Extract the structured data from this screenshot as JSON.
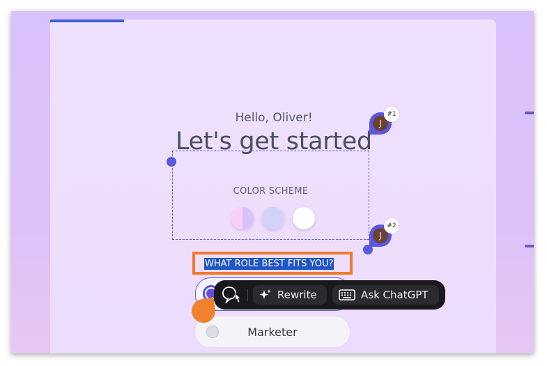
{
  "greeting": "Hello, Oliver!",
  "heading": "Let's get started",
  "color_scheme": {
    "label": "COLOR SCHEME",
    "swatches": [
      {
        "name": "split-pink-lavender",
        "colors": [
          "#fbd0f4",
          "#d6c3fb"
        ]
      },
      {
        "name": "periwinkle",
        "colors": [
          "#d3d2fb"
        ]
      },
      {
        "name": "white",
        "colors": [
          "#ffffff"
        ]
      }
    ]
  },
  "role_question": "WHAT ROLE BEST FITS YOU?",
  "options": [
    {
      "label": "Marketer",
      "selected": false
    }
  ],
  "toolbar": {
    "rewrite_label": "Rewrite",
    "ask_label": "Ask ChatGPT"
  },
  "pins": [
    {
      "badge": "#1",
      "initial": "J"
    },
    {
      "badge": "#2",
      "initial": "J"
    }
  ],
  "colors": {
    "accent": "#5b4fdb",
    "highlight": "#1f55c5",
    "outline": "#f07a2a",
    "toolbar_bg": "#19181d"
  }
}
